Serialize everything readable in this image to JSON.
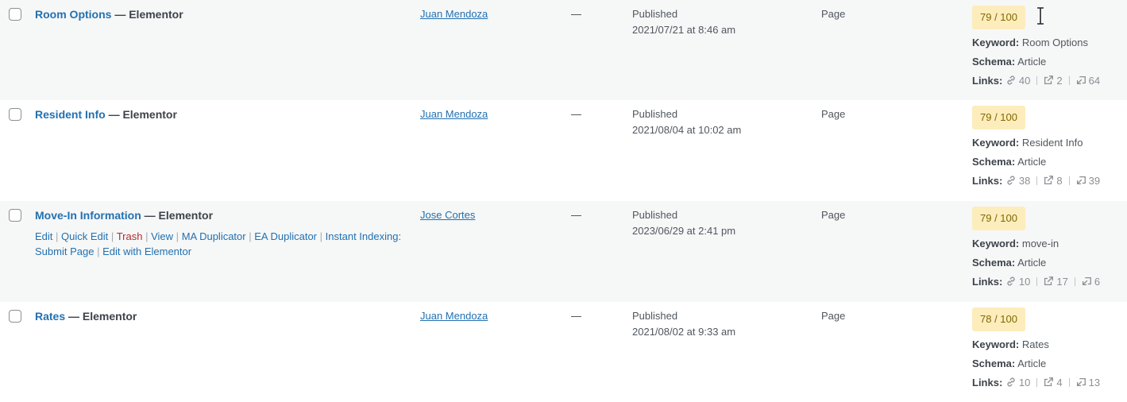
{
  "rows": [
    {
      "title": "Room Options",
      "state": "— Elementor",
      "author": "Juan Mendoza",
      "comments": "—",
      "status": "Published",
      "date": "2021/07/21 at 8:46 am",
      "type": "Page",
      "score": "79 / 100",
      "keyword_label": "Keyword:",
      "keyword": "Room Options",
      "schema_label": "Schema:",
      "schema": "Article",
      "links_label": "Links:",
      "internal": "40",
      "external": "2",
      "incoming": "64"
    },
    {
      "title": "Resident Info",
      "state": "— Elementor",
      "author": "Juan Mendoza",
      "comments": "—",
      "status": "Published",
      "date": "2021/08/04 at 10:02 am",
      "type": "Page",
      "score": "79 / 100",
      "keyword_label": "Keyword:",
      "keyword": "Resident Info",
      "schema_label": "Schema:",
      "schema": "Article",
      "links_label": "Links:",
      "internal": "38",
      "external": "8",
      "incoming": "39"
    },
    {
      "title": "Move-In Information",
      "state": "— Elementor",
      "author": "Jose Cortes",
      "comments": "—",
      "status": "Published",
      "date": "2023/06/29 at 2:41 pm",
      "type": "Page",
      "score": "79 / 100",
      "keyword_label": "Keyword:",
      "keyword": "move-in",
      "schema_label": "Schema:",
      "schema": "Article",
      "links_label": "Links:",
      "internal": "10",
      "external": "17",
      "incoming": "6",
      "actions": {
        "edit": "Edit",
        "quick_edit": "Quick Edit",
        "trash": "Trash",
        "view": "View",
        "ma_duplicator": "MA Duplicator",
        "ea_duplicator": "EA Duplicator",
        "instant_indexing": "Instant Indexing:",
        "submit_page": "Submit Page",
        "edit_elementor": "Edit with Elementor",
        "separator": "|"
      }
    },
    {
      "title": "Rates",
      "state": "— Elementor",
      "author": "Juan Mendoza",
      "comments": "—",
      "status": "Published",
      "date": "2021/08/02 at 9:33 am",
      "type": "Page",
      "score": "78 / 100",
      "keyword_label": "Keyword:",
      "keyword": "Rates",
      "schema_label": "Schema:",
      "schema": "Article",
      "links_label": "Links:",
      "internal": "10",
      "external": "4",
      "incoming": "13"
    }
  ],
  "icons": {
    "checkbox": "checkbox",
    "internal_link": "link-icon",
    "external_link": "external-link-icon",
    "incoming_link": "incoming-link-icon",
    "cursor": "text-cursor-icon"
  },
  "colors": {
    "link": "#2271b1",
    "trash": "#b32d2e",
    "score_bg": "#fdedbc",
    "score_text": "#806700",
    "row_alt": "#f6f7f7"
  }
}
